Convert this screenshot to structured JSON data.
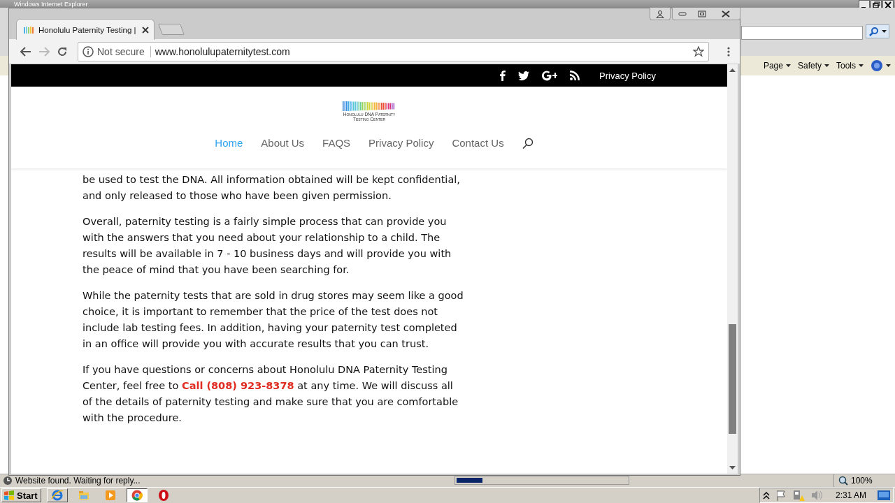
{
  "ie": {
    "title": "Windows Internet Explorer",
    "command_bar": [
      {
        "label": "Page"
      },
      {
        "label": "Safety"
      },
      {
        "label": "Tools"
      }
    ],
    "status_text": "Website found. Waiting for reply...",
    "progress": {
      "level": 0.15
    },
    "zoom": "100%"
  },
  "chrome": {
    "tab": {
      "title": "Honolulu Paternity Testing |",
      "selected": true
    },
    "security": "Not secure",
    "url": "www.honolulupaternitytest.com"
  },
  "site": {
    "top_link": "Privacy Policy",
    "logo_lines": [
      "Honolulu DNA Paternity",
      "Testing Center"
    ],
    "nav": [
      {
        "label": "Home",
        "selected": true
      },
      {
        "label": "About Us",
        "selected": false
      },
      {
        "label": "FAQS",
        "selected": false
      },
      {
        "label": "Privacy Policy",
        "selected": false
      },
      {
        "label": "Contact Us",
        "selected": false
      }
    ],
    "paragraphs": [
      "be used to test the DNA. All information obtained will be kept confidential, and only released to those who have been given permission.",
      "Overall, paternity testing is a fairly simple process that can provide you with the answers that you need about your relationship to a child. The results will be available in 7 - 10 business days and will provide you with the peace of mind that you have been searching for.",
      "While the paternity tests that are sold in drug stores may seem like a good choice, it is important to remember that the price of the test does not include lab testing fees. In addition, having your paternity test completed in an office will provide you with accurate results that you can trust.",
      "If you have questions or concerns about Honolulu DNA Paternity Testing Center, feel free to **Call (808) 923-8378** at any time. We will discuss all of the details of paternity testing and make sure that you are comfortable with the procedure."
    ]
  },
  "taskbar": {
    "start": "Start",
    "clock": "2:31 AM"
  }
}
